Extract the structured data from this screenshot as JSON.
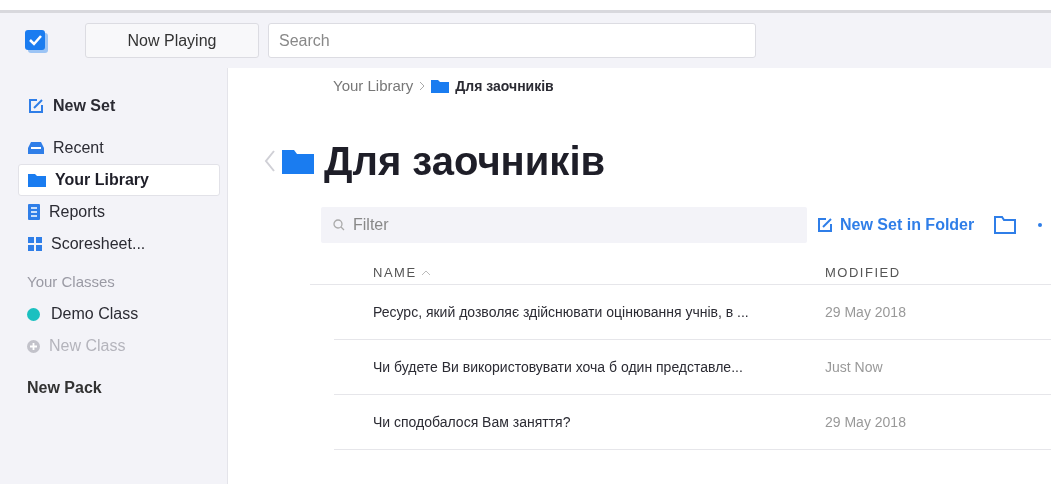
{
  "header": {
    "now_playing": "Now Playing",
    "search": {
      "placeholder": "Search"
    }
  },
  "sidebar": {
    "items": [
      {
        "kind": "action",
        "label": "New Set",
        "selected": false
      },
      {
        "kind": "nav",
        "label": "Recent",
        "selected": false
      },
      {
        "kind": "nav",
        "label": "Your Library",
        "selected": true
      },
      {
        "kind": "nav",
        "label": "Reports",
        "selected": false
      },
      {
        "kind": "nav",
        "label": "Scoresheet...",
        "selected": false
      },
      {
        "kind": "section",
        "label": "Your Classes"
      },
      {
        "kind": "class",
        "label": "Demo Class",
        "color": "#1bc0c0"
      },
      {
        "kind": "add",
        "label": "New Class",
        "disabled": true
      },
      {
        "kind": "pack",
        "label": "New Pack"
      }
    ]
  },
  "breadcrumb": [
    "Your Library",
    "Для заочників"
  ],
  "title": "Для заочників",
  "filter": {
    "placeholder": "Filter"
  },
  "new_set_in_folder": "New Set in Folder",
  "table": {
    "columns": [
      {
        "label": "NAME",
        "sorted": true
      },
      {
        "label": "MODIFIED",
        "sorted": false
      }
    ],
    "rows": [
      {
        "name": "Ресурс, який дозволяє здійснювати оцінювання учнів, в ...",
        "modified": "29 May 2018"
      },
      {
        "name": "Чи будете Ви використовувати хоча б один представле...",
        "modified": "Just Now"
      },
      {
        "name": "Чи сподобалося Вам заняття?",
        "modified": "29 May 2018"
      }
    ]
  }
}
